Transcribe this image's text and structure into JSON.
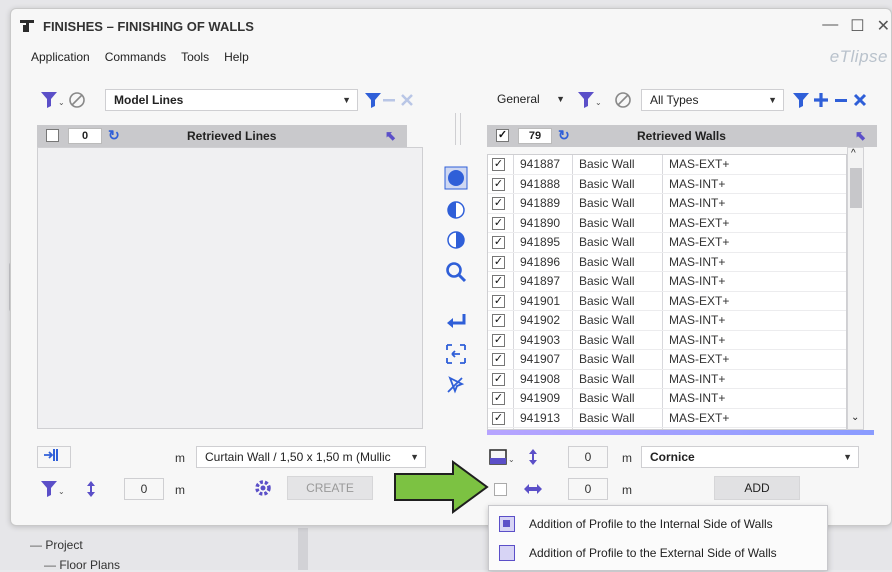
{
  "window": {
    "title": "FINISHES – FINISHING OF WALLS",
    "controls": [
      "—",
      "☐",
      "✕"
    ],
    "brand": "eTlipse"
  },
  "menu": [
    "Application",
    "Commands",
    "Tools",
    "Help"
  ],
  "left_panel": {
    "filter_combo": "Model Lines",
    "count": "0",
    "header_title": "Retrieved Lines",
    "unit_label": "m",
    "type_combo": "Curtain Wall / 1,50 x 1,50 m (Mullic",
    "offset_value": "0",
    "offset_unit": "m",
    "create_label": "CREATE"
  },
  "right_panel": {
    "category_combo": "General",
    "type_filter_combo": "All Types",
    "count": "79",
    "header_title": "Retrieved Walls",
    "rows": [
      {
        "id": "941887",
        "family": "Basic Wall",
        "type": "MAS-EXT+",
        "checked": true
      },
      {
        "id": "941888",
        "family": "Basic Wall",
        "type": "MAS-INT+",
        "checked": true
      },
      {
        "id": "941889",
        "family": "Basic Wall",
        "type": "MAS-INT+",
        "checked": true
      },
      {
        "id": "941890",
        "family": "Basic Wall",
        "type": "MAS-EXT+",
        "checked": true
      },
      {
        "id": "941895",
        "family": "Basic Wall",
        "type": "MAS-EXT+",
        "checked": true
      },
      {
        "id": "941896",
        "family": "Basic Wall",
        "type": "MAS-INT+",
        "checked": true
      },
      {
        "id": "941897",
        "family": "Basic Wall",
        "type": "MAS-INT+",
        "checked": true
      },
      {
        "id": "941901",
        "family": "Basic Wall",
        "type": "MAS-EXT+",
        "checked": true
      },
      {
        "id": "941902",
        "family": "Basic Wall",
        "type": "MAS-INT+",
        "checked": true
      },
      {
        "id": "941903",
        "family": "Basic Wall",
        "type": "MAS-INT+",
        "checked": true
      },
      {
        "id": "941907",
        "family": "Basic Wall",
        "type": "MAS-EXT+",
        "checked": true
      },
      {
        "id": "941908",
        "family": "Basic Wall",
        "type": "MAS-INT+",
        "checked": true
      },
      {
        "id": "941909",
        "family": "Basic Wall",
        "type": "MAS-INT+",
        "checked": true
      },
      {
        "id": "941913",
        "family": "Basic Wall",
        "type": "MAS-EXT+",
        "checked": true
      }
    ],
    "height_value": "0",
    "height_unit": "m",
    "profile_combo": "Cornice",
    "offset_value": "0",
    "offset_unit": "m",
    "add_label": "ADD"
  },
  "popup": {
    "items": [
      "Addition of Profile to the Internal Side of Walls",
      "Addition of Profile to the External Side of Walls"
    ]
  },
  "tree": {
    "items": [
      "Project",
      "Floor Plans"
    ]
  },
  "colors": {
    "accent_blue": "#2f5fd8",
    "accent_purple": "#5b4fc8",
    "arrow_green": "#7cc242"
  }
}
